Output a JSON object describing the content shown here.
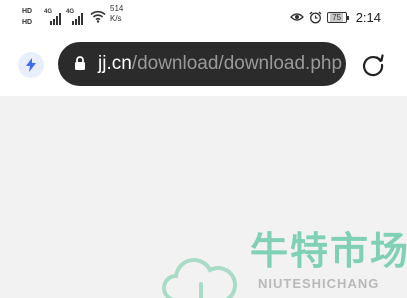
{
  "status_bar": {
    "sim1_label": "HD",
    "sim2_label": "HD",
    "network1": "4G",
    "network2": "4G",
    "speed_value": "514",
    "speed_unit": "K/s",
    "battery_level": "75",
    "time": "2:14"
  },
  "toolbar": {
    "url_host": "jj.cn",
    "url_path": "/download/download.php"
  },
  "watermark": {
    "chinese": "牛特市场",
    "pinyin": "NIUTESHICHANG"
  },
  "colors": {
    "url_bar_bg": "#2b2b2b",
    "watermark_green": "#7fd0b4",
    "accent_blue": "#3d6cf0"
  }
}
